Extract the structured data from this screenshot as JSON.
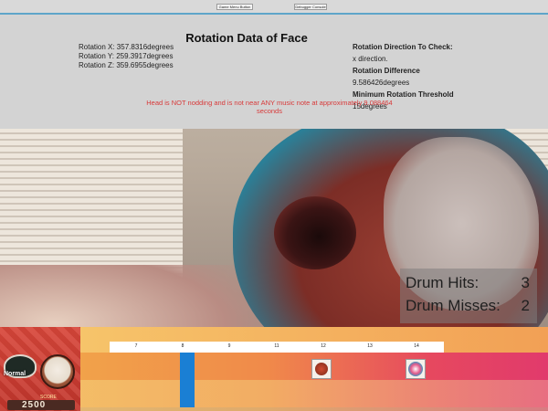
{
  "top_buttons": {
    "left_label": "Game Menu Button",
    "right_label": "Debugger Console"
  },
  "debug_panel": {
    "title": "Rotation Data of Face",
    "rotation_x": "Rotation X: 357.8316degrees",
    "rotation_y": "Rotation Y: 259.3917degrees",
    "rotation_z": "Rotation Z: 359.6955degrees",
    "direction_heading": "Rotation Direction To Check:",
    "direction_value": "x direction.",
    "difference_heading": "Rotation Difference",
    "difference_value": "9.586426degrees",
    "threshold_heading": "Minimum Rotation Threshold",
    "threshold_value": "15degrees",
    "status_message": "Head is NOT nodding and is not near ANY music note at approximately 9.088464 seconds"
  },
  "drum_stats": {
    "hits_label": "Drum Hits:",
    "hits_value": "3",
    "misses_label": "Drum Misses:",
    "misses_value": "2"
  },
  "player_panel": {
    "mode": "Normal",
    "score_label": "SCORE",
    "score": "2500"
  },
  "timeline": {
    "ticks": [
      "7",
      "8",
      "9",
      "11",
      "12",
      "13",
      "14"
    ]
  },
  "colors": {
    "panel_bg": "#d3d3d3",
    "status_text": "#d83a3a",
    "hit_line": "#1a7fd4",
    "lane_start": "#f1a24a",
    "lane_end": "#e13a6c"
  }
}
